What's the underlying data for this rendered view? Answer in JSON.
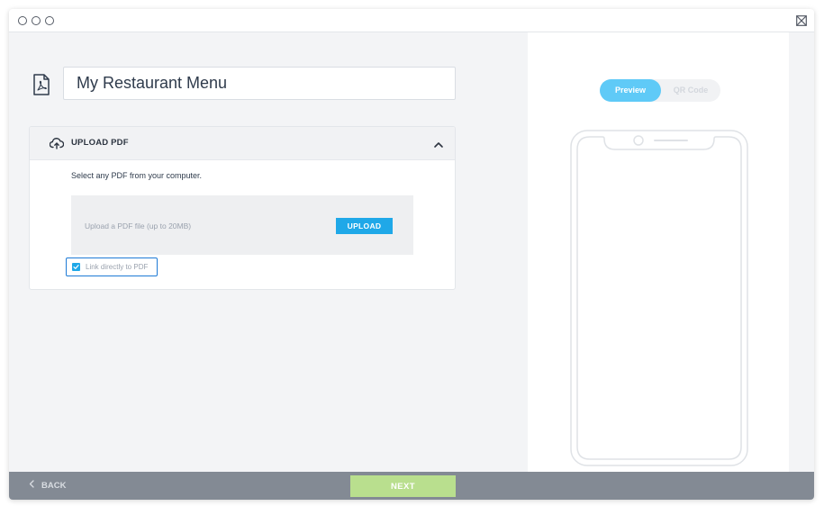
{
  "window": {
    "traffic_lights": [
      "circle-icon",
      "circle-icon",
      "circle-icon"
    ],
    "close_icon": "close-box-icon"
  },
  "editor": {
    "file_icon": "pdf-icon",
    "title_value": "My Restaurant Menu",
    "upload_section": {
      "icon": "cloud-upload-icon",
      "title": "UPLOAD PDF",
      "collapse_icon": "chevron-up-icon",
      "helper_text": "Select any PDF from your computer.",
      "dropzone_text": "Upload a PDF file (up to 20MB)",
      "upload_label": "UPLOAD",
      "link_checkbox_label": "Link directly to PDF",
      "link_checkbox_checked": true
    }
  },
  "preview": {
    "tabs": [
      {
        "label": "Preview",
        "active": true
      },
      {
        "label": "QR Code",
        "active": false
      }
    ],
    "device": "phone-frame"
  },
  "footer": {
    "back_label": "BACK",
    "next_label": "NEXT"
  },
  "colors": {
    "accent": "#1fa8e8",
    "toggle_active": "#5fcaf7",
    "next_button": "#b9df8e",
    "footer_bar": "#838a94",
    "checkbox_border": "#1e7ad6"
  }
}
